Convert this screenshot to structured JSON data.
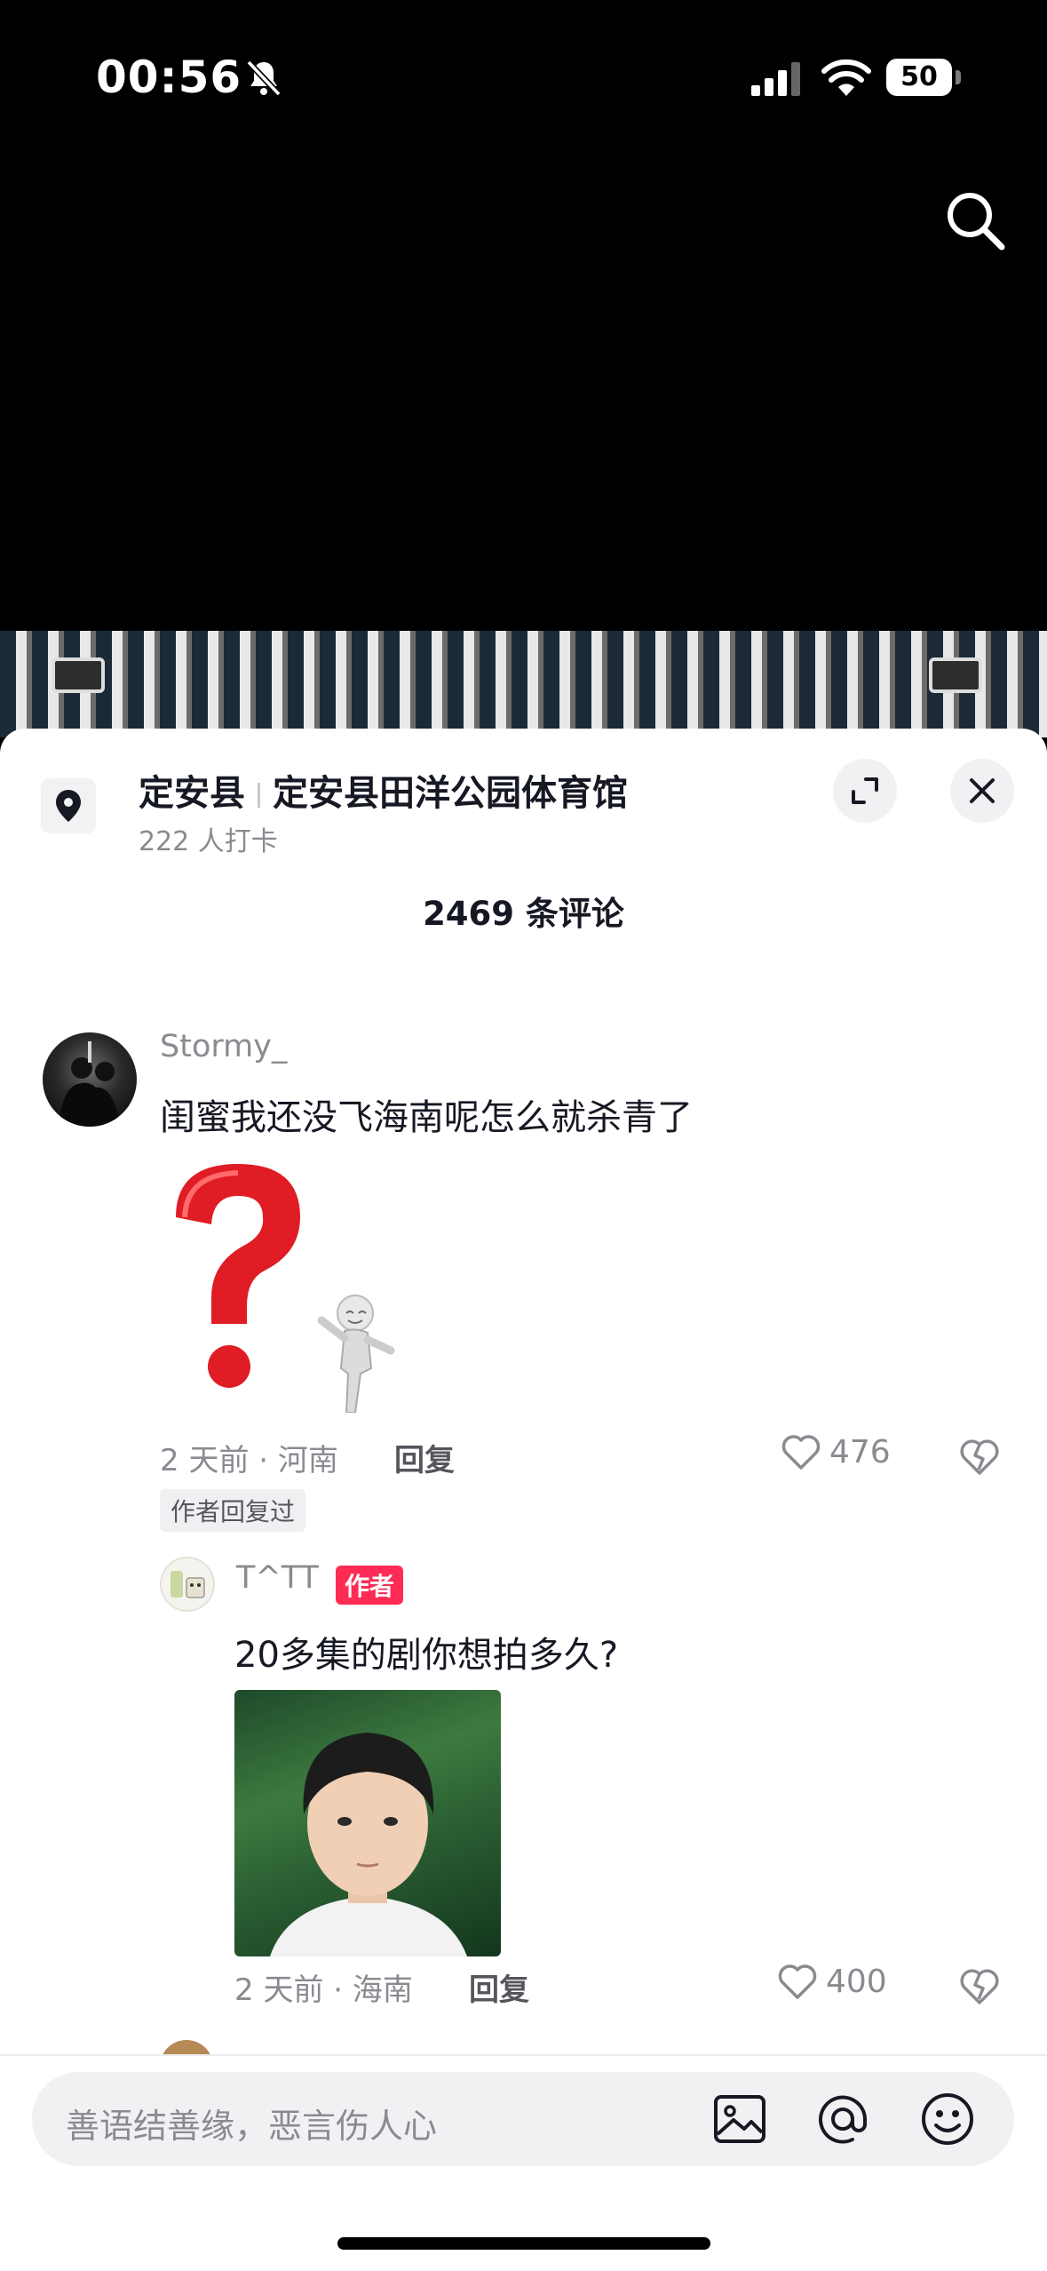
{
  "status_bar": {
    "time": "00:56",
    "battery": "50"
  },
  "location": {
    "county": "定安县",
    "place": "定安县田洋公园体育馆",
    "checkins": "222 人打卡"
  },
  "comments_header": "2469 条评论",
  "comment": {
    "author": "Stormy_",
    "text": "闺蜜我还没飞海南呢怎么就杀青了",
    "meta": "2 天前 · 河南",
    "reply_label": "回复",
    "likes": "476",
    "author_replied_badge": "作者回复过"
  },
  "reply": {
    "author": "T^TT",
    "author_tag": "作者",
    "text": "20多集的剧你想拍多久?",
    "meta": "2 天前 · 海南",
    "reply_label": "回复",
    "likes": "400"
  },
  "input": {
    "placeholder": "善语结善缘，恶言伤人心"
  },
  "icons": [
    "bell-slash-icon",
    "signal-icon",
    "wifi-icon",
    "battery-icon",
    "search-icon",
    "location-pin-icon",
    "expand-icon",
    "close-icon",
    "heart-icon",
    "broken-heart-icon",
    "image-icon",
    "at-icon",
    "emoji-icon"
  ]
}
